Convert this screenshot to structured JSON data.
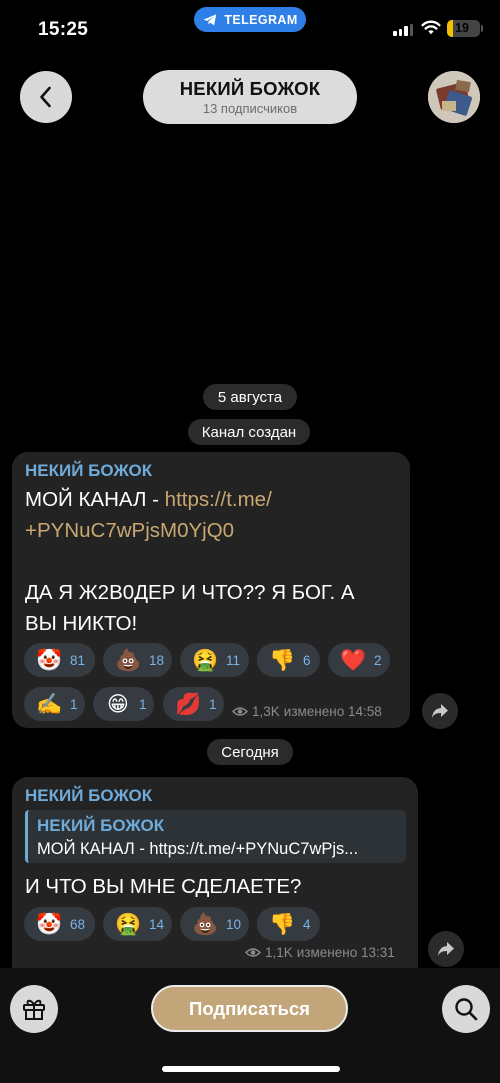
{
  "status_bar": {
    "time": "15:25",
    "app_pill": "TELEGRAM",
    "battery": "19",
    "battery_fraction": 0.19
  },
  "header": {
    "channel_name": "НЕКИЙ БОЖОК",
    "subscribers": "13 подписчиков",
    "back_icon": "chevron-left-icon",
    "avatar": "channel-avatar"
  },
  "dates": {
    "first": "5 августа",
    "service_message": "Канал создан",
    "today": "Сегодня"
  },
  "message1": {
    "author": "НЕКИЙ БОЖОК",
    "line1_prefix": "МОЙ КАНАЛ - ",
    "link_line1": "https://t.me/",
    "link_line2": "+PYNuC7wPjsM0YjQ0",
    "text_line1": "ДА Я Ж2В0ДЕР И ЧТО?? Я БОГ. А",
    "text_line2": "ВЫ НИКТО!",
    "reactions": [
      {
        "emoji": "🤡",
        "count": "81"
      },
      {
        "emoji": "💩",
        "count": "18"
      },
      {
        "emoji": "🤮",
        "count": "11"
      },
      {
        "emoji": "👎",
        "count": "6"
      },
      {
        "emoji": "❤️",
        "count": "2"
      },
      {
        "emoji": "✍️",
        "count": "1"
      },
      {
        "emoji": "😁",
        "count": "1"
      },
      {
        "emoji": "💋",
        "count": "1"
      }
    ],
    "views": "1,3K",
    "edited": "изменено 14:58"
  },
  "message2": {
    "author": "НЕКИЙ БОЖОК",
    "reply_author": "НЕКИЙ БОЖОК",
    "reply_text": "МОЙ КАНАЛ - https://t.me/+PYNuC7wPjs...",
    "text": "И ЧТО ВЫ МНЕ СДЕЛАЕТЕ?",
    "reactions": [
      {
        "emoji": "🤡",
        "count": "68"
      },
      {
        "emoji": "🤮",
        "count": "14"
      },
      {
        "emoji": "💩",
        "count": "10"
      },
      {
        "emoji": "👎",
        "count": "4"
      }
    ],
    "views": "1,1K",
    "edited": "изменено 13:31"
  },
  "bottom_bar": {
    "subscribe_label": "Подписаться",
    "gift_icon": "gift-icon",
    "search_icon": "search-icon"
  },
  "colors": {
    "accent_blue": "#6faad8",
    "link_gold": "#c9a770",
    "subscribe_gold": "#c2a67a",
    "telegram_blue": "#2f7fe8",
    "battery_yellow": "#f2c200"
  }
}
